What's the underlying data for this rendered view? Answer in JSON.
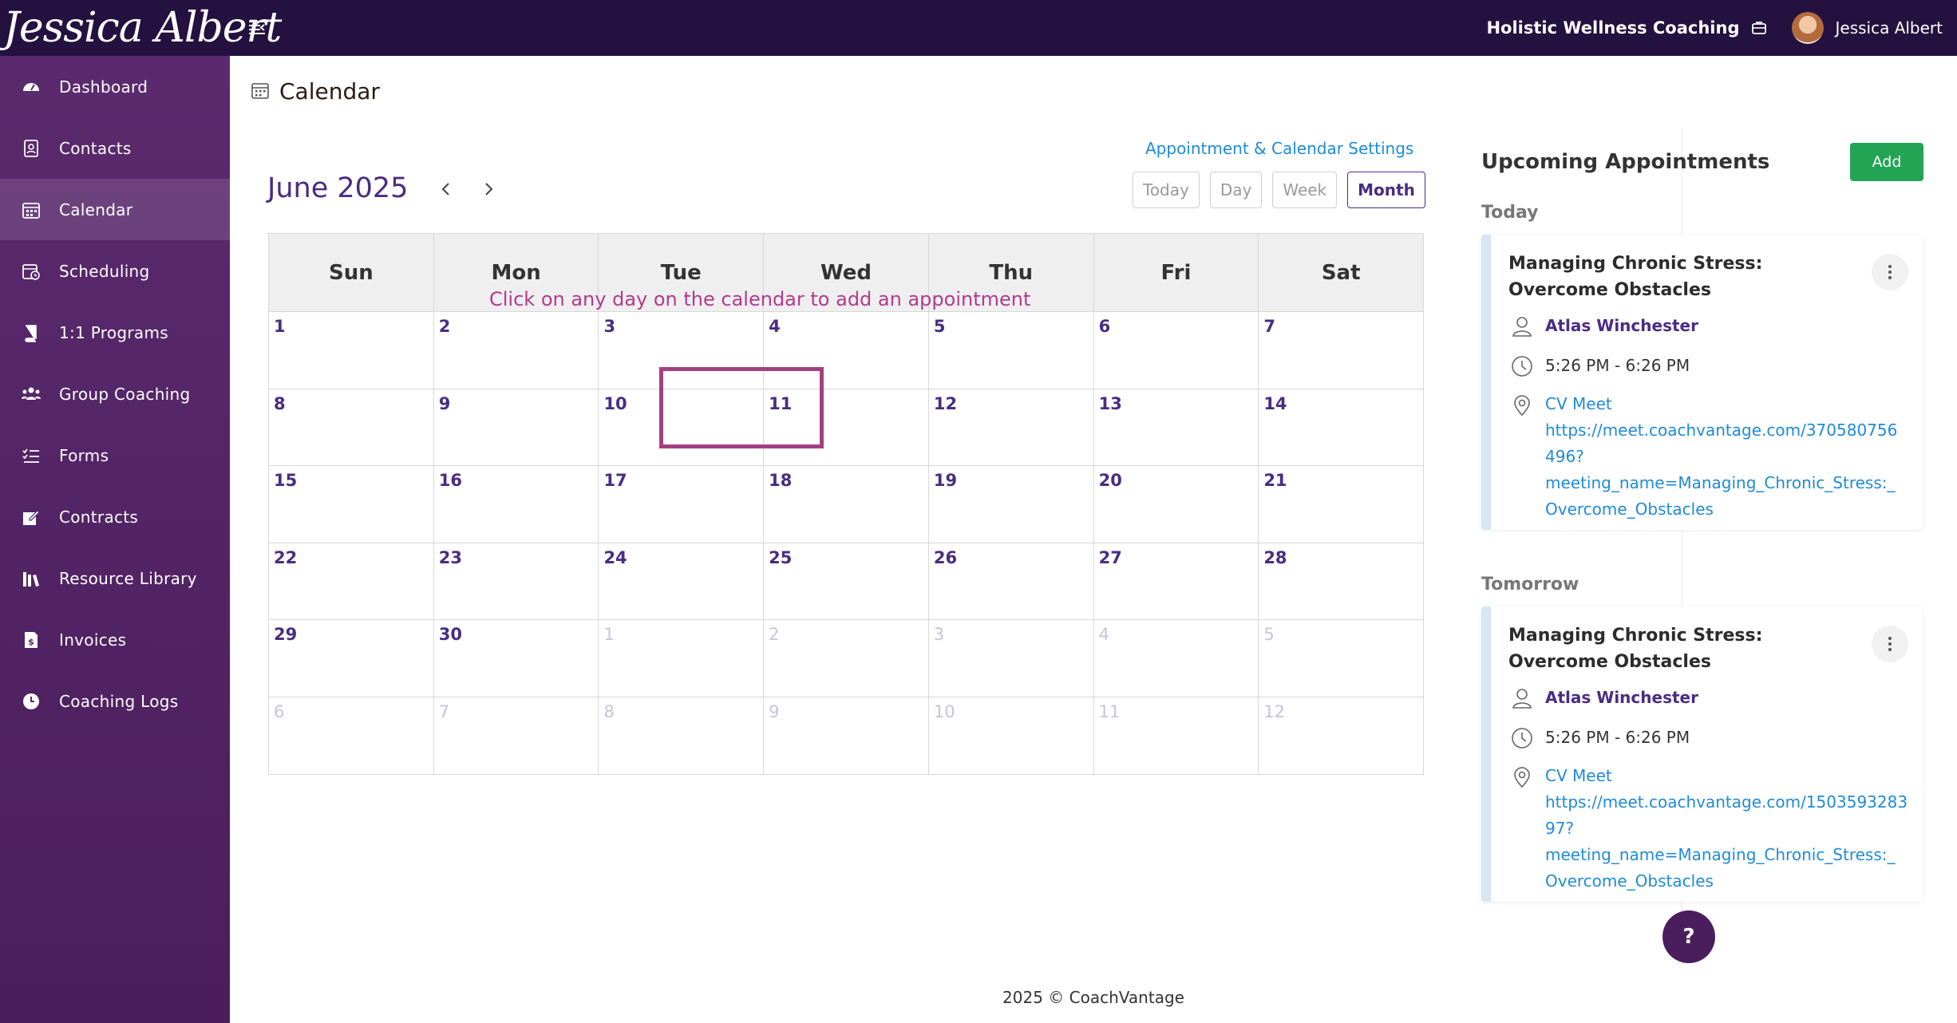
{
  "topbar": {
    "brand": "Jessica Albert",
    "org_name": "Holistic Wellness Coaching",
    "user_name": "Jessica Albert"
  },
  "sidebar": {
    "items": [
      {
        "label": "Dashboard",
        "icon": "dashboard-icon"
      },
      {
        "label": "Contacts",
        "icon": "contacts-icon"
      },
      {
        "label": "Calendar",
        "icon": "calendar-icon",
        "active": true
      },
      {
        "label": "Scheduling",
        "icon": "scheduling-icon"
      },
      {
        "label": "1:1 Programs",
        "icon": "book-icon"
      },
      {
        "label": "Group Coaching",
        "icon": "group-icon"
      },
      {
        "label": "Forms",
        "icon": "forms-icon"
      },
      {
        "label": "Contracts",
        "icon": "contract-icon"
      },
      {
        "label": "Resource Library",
        "icon": "library-icon"
      },
      {
        "label": "Invoices",
        "icon": "invoice-icon"
      },
      {
        "label": "Coaching Logs",
        "icon": "clock-icon"
      }
    ]
  },
  "page": {
    "title": "Calendar"
  },
  "calendar": {
    "settings_link": "Appointment & Calendar Settings",
    "month_label": "June 2025",
    "views": [
      "Today",
      "Day",
      "Week",
      "Month"
    ],
    "active_view": "Month",
    "weekdays": [
      "Sun",
      "Mon",
      "Tue",
      "Wed",
      "Thu",
      "Fri",
      "Sat"
    ],
    "hint": "Click on any day on the calendar to add an appointment",
    "weeks": [
      [
        {
          "d": "1"
        },
        {
          "d": "2"
        },
        {
          "d": "3"
        },
        {
          "d": "4"
        },
        {
          "d": "5"
        },
        {
          "d": "6"
        },
        {
          "d": "7"
        }
      ],
      [
        {
          "d": "8"
        },
        {
          "d": "9"
        },
        {
          "d": "10"
        },
        {
          "d": "11"
        },
        {
          "d": "12"
        },
        {
          "d": "13"
        },
        {
          "d": "14"
        }
      ],
      [
        {
          "d": "15"
        },
        {
          "d": "16"
        },
        {
          "d": "17"
        },
        {
          "d": "18"
        },
        {
          "d": "19"
        },
        {
          "d": "20"
        },
        {
          "d": "21"
        }
      ],
      [
        {
          "d": "22"
        },
        {
          "d": "23"
        },
        {
          "d": "24"
        },
        {
          "d": "25"
        },
        {
          "d": "26"
        },
        {
          "d": "27"
        },
        {
          "d": "28"
        }
      ],
      [
        {
          "d": "29"
        },
        {
          "d": "30"
        },
        {
          "d": "1",
          "m": true
        },
        {
          "d": "2",
          "m": true
        },
        {
          "d": "3",
          "m": true
        },
        {
          "d": "4",
          "m": true
        },
        {
          "d": "5",
          "m": true
        }
      ],
      [
        {
          "d": "6",
          "m": true
        },
        {
          "d": "7",
          "m": true
        },
        {
          "d": "8",
          "m": true
        },
        {
          "d": "9",
          "m": true
        },
        {
          "d": "10",
          "m": true
        },
        {
          "d": "11",
          "m": true
        },
        {
          "d": "12",
          "m": true
        }
      ]
    ]
  },
  "upcoming": {
    "title": "Upcoming Appointments",
    "add_label": "Add",
    "groups": [
      {
        "label": "Today",
        "appointment": {
          "title": "Managing Chronic Stress: Overcome Obstacles",
          "client": "Atlas Winchester",
          "time": "5:26 PM - 6:26 PM",
          "location_name": "CV Meet",
          "location_url_lines": [
            "https://meet.coachvantage.com/370580756",
            "496?",
            "meeting_name=Managing_Chronic_Stress:_",
            "Overcome_Obstacles"
          ]
        }
      },
      {
        "label": "Tomorrow",
        "appointment": {
          "title": "Managing Chronic Stress: Overcome Obstacles",
          "client": "Atlas Winchester",
          "time": "5:26 PM - 6:26 PM",
          "location_name": "CV Meet",
          "location_url_lines": [
            "https://meet.coachvantage.com/1503593283",
            "97?",
            "meeting_name=Managing_Chronic_Stress:_",
            "Overcome_Obstacles"
          ]
        }
      }
    ]
  },
  "help_label": "?",
  "footer": "2025 © CoachVantage"
}
